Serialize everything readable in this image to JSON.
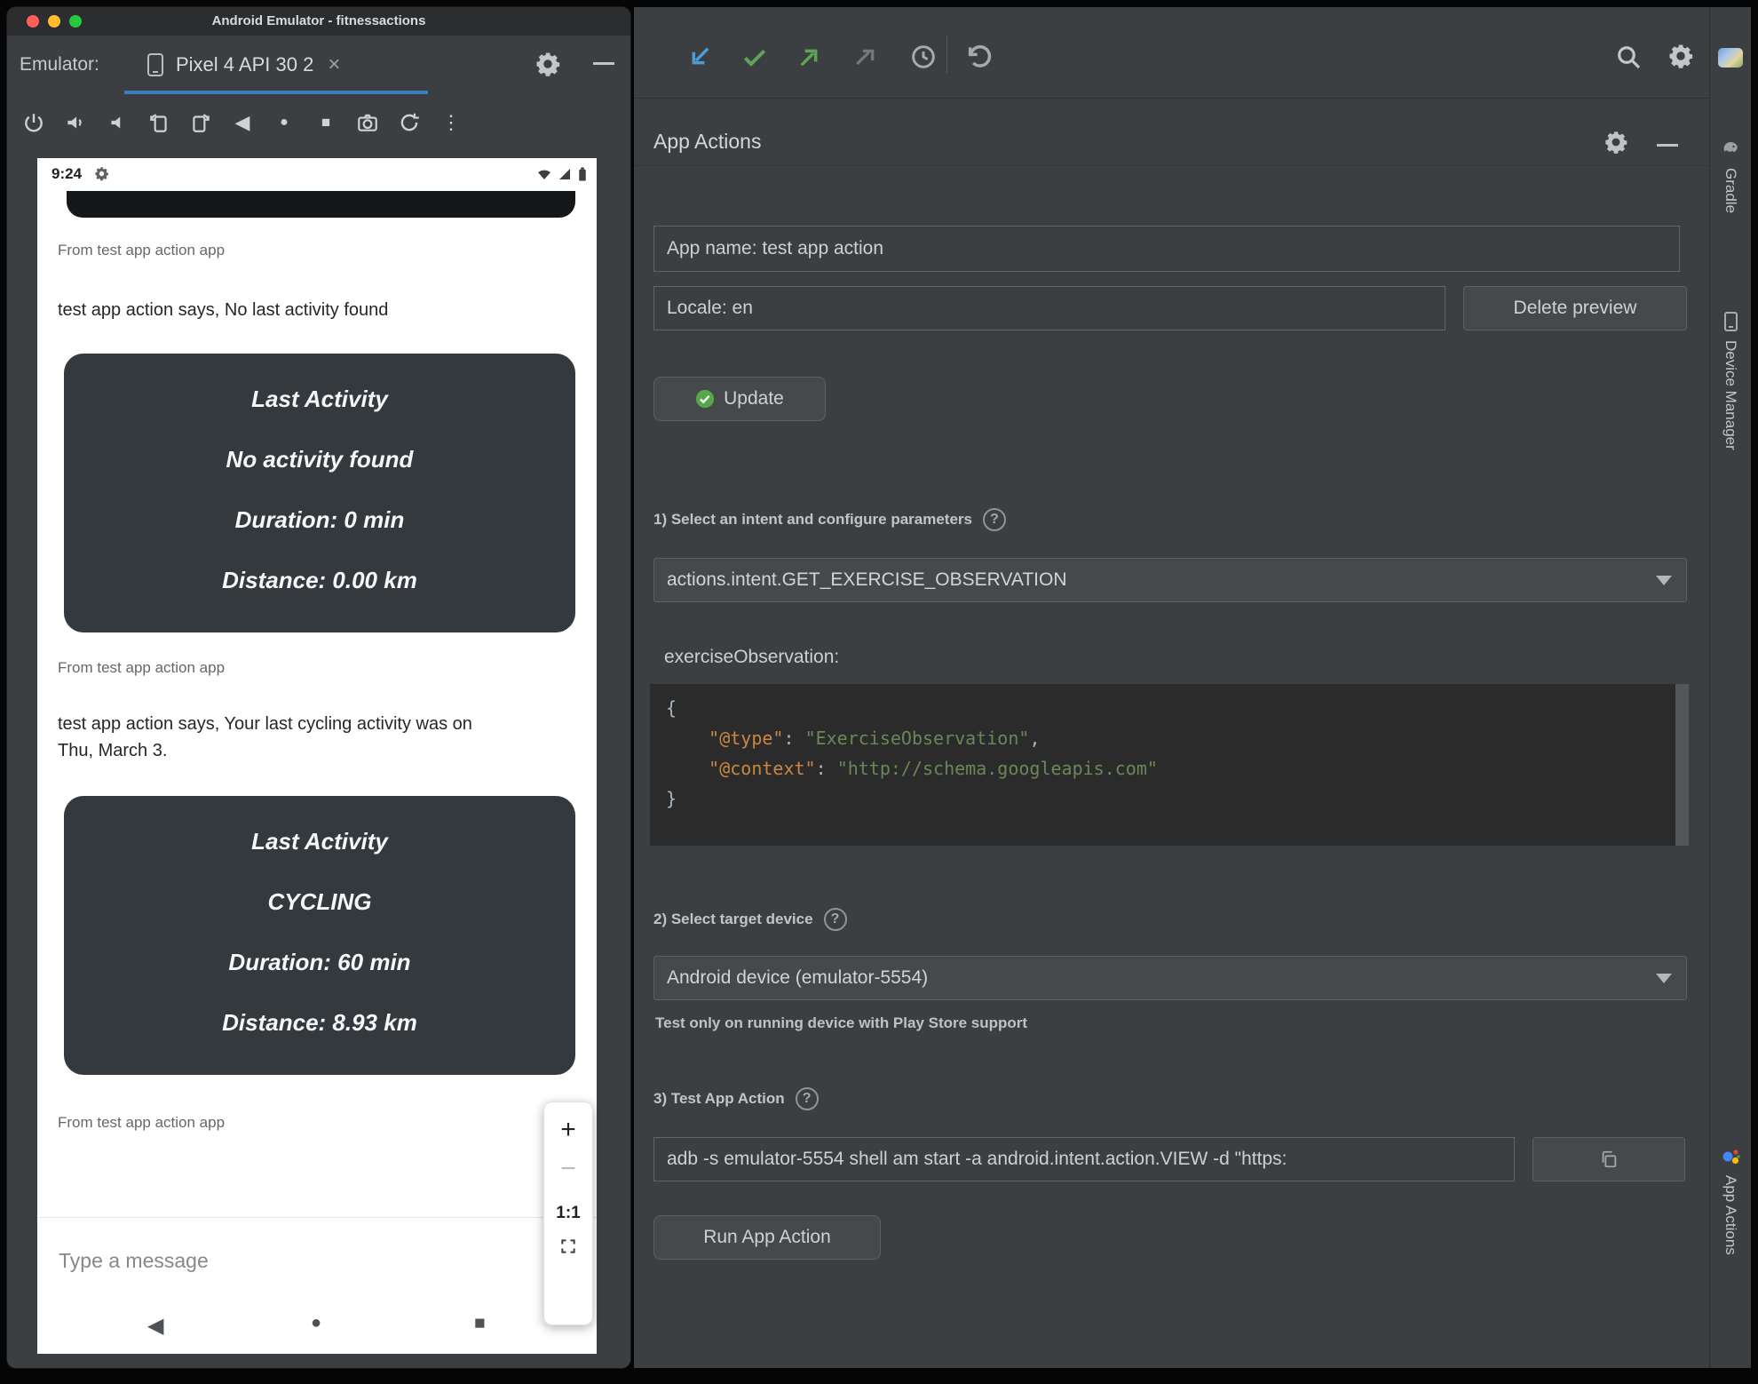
{
  "icons": {
    "close_tab": "×",
    "kebab": "⋮",
    "nav_back": "◀",
    "nav_home": "●",
    "nav_recents": "■",
    "zoom_in": "+",
    "zoom_out": "−",
    "help": "?"
  },
  "colors": {
    "tab_accent": "#3d7ebf",
    "traffic_red": "#ff5f57",
    "traffic_yellow": "#febc2e",
    "traffic_green": "#28c840",
    "success_green": "#57a64a",
    "code_key": "#cb8742",
    "code_string": "#6a8759",
    "chat_card_bg": "#34393d"
  },
  "emulator": {
    "window_title": "Android Emulator - fitnessactions",
    "toolbar_label": "Emulator:",
    "tab_label": "Pixel 4 API 30 2",
    "status_time": "9:24",
    "messages": [
      {
        "from": "From test app action app",
        "text": "test app action says, No last activity found"
      },
      {
        "from": "From test app action app",
        "text": "test app action says, Your last cycling activity was on Thu, March 3."
      },
      {
        "from": "From test app action app",
        "text": ""
      }
    ],
    "cards": [
      {
        "title": "Last Activity",
        "lines": [
          "No activity found",
          "Duration: 0 min",
          "Distance: 0.00 km"
        ]
      },
      {
        "title": "Last Activity",
        "lines": [
          "CYCLING",
          "Duration: 60 min",
          "Distance: 8.93 km"
        ]
      }
    ],
    "zoom_ratio": "1:1",
    "message_placeholder": "Type a message"
  },
  "studio": {
    "panel_title": "App Actions",
    "app_name": "App name: test app action",
    "locale": "Locale: en",
    "delete_preview": "Delete preview",
    "update": "Update",
    "step1": "1) Select an intent and configure parameters",
    "intent": "actions.intent.GET_EXERCISE_OBSERVATION",
    "param_name": "exerciseObservation:",
    "code": {
      "l1": "{",
      "indent": "    ",
      "k1": "\"@type\"",
      "colon": ": ",
      "v1": "\"ExerciseObservation\"",
      "comma": ",",
      "k2": "\"@context\"",
      "v2": "\"http://schema.googleapis.com\"",
      "l4": "}"
    },
    "step2": "2) Select target device",
    "device": "Android device (emulator-5554)",
    "device_hint": "Test only on running device with Play Store support",
    "step3": "3) Test App Action",
    "adb_command": "adb -s emulator-5554 shell am start -a android.intent.action.VIEW -d \"https:",
    "run": "Run App Action",
    "sidebar": {
      "gradle": "Gradle",
      "device_manager": "Device Manager",
      "app_actions": "App Actions"
    }
  }
}
